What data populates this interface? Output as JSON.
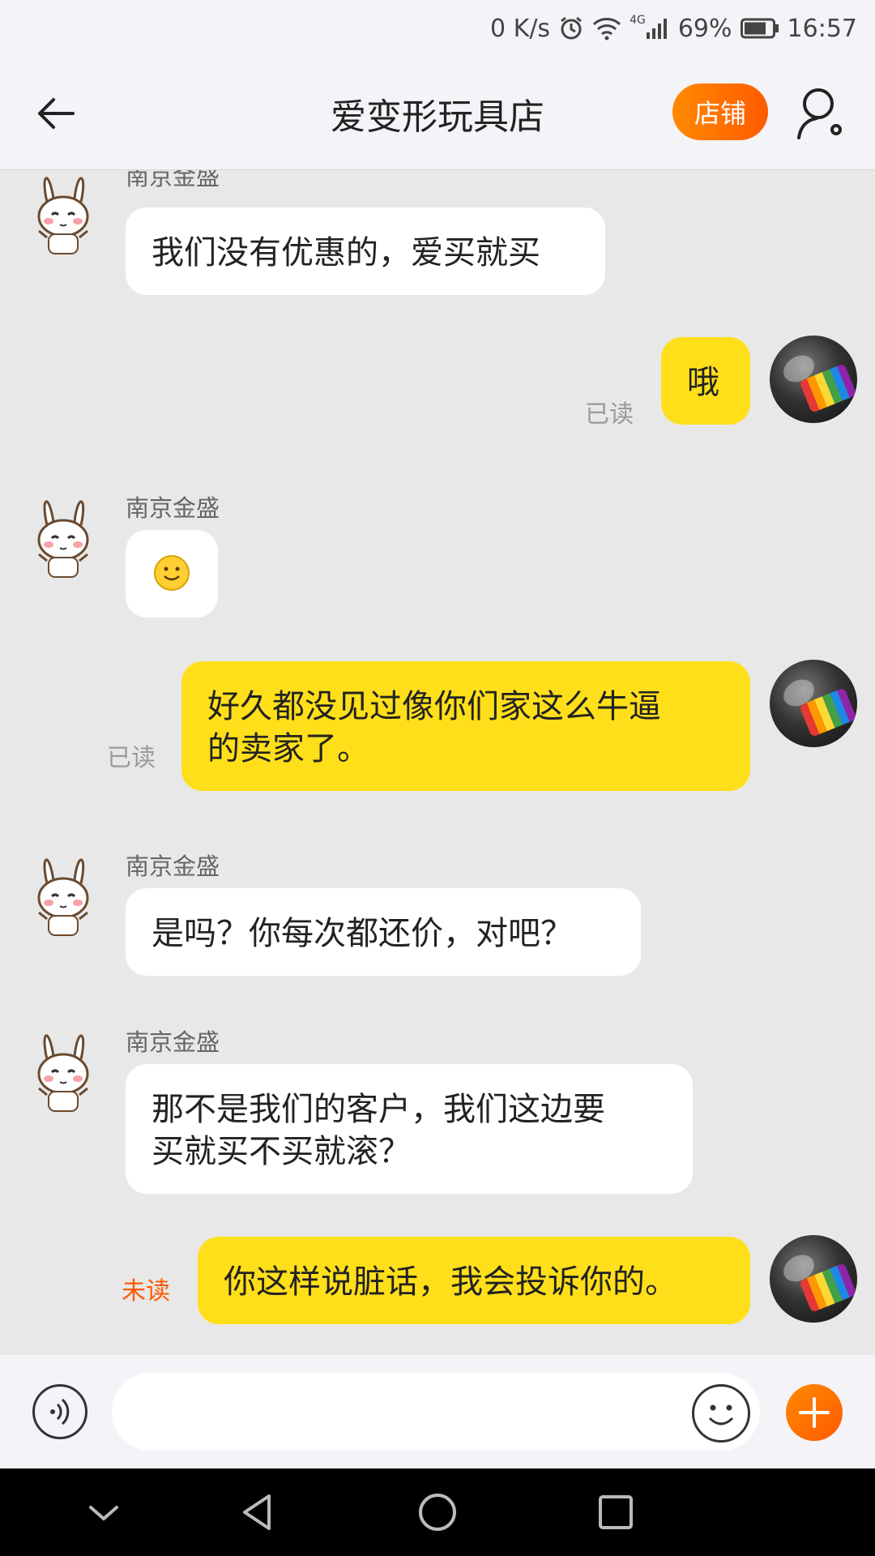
{
  "status_bar": {
    "network_speed": "0 K/s",
    "network_type": "4G",
    "battery_percent": "69%",
    "time": "16:57",
    "icons": [
      "alarm-icon",
      "wifi-icon",
      "signal-icon",
      "battery-icon"
    ]
  },
  "header": {
    "title": "爱变形玩具店",
    "shop_button_label": "店铺",
    "icons": [
      "back-arrow-icon",
      "user-settings-icon"
    ]
  },
  "messages": [
    {
      "direction": "in",
      "sender": "南京金盛",
      "text": "我们没有优惠的，爱买就买"
    },
    {
      "direction": "out",
      "text": "哦",
      "status": "已读"
    },
    {
      "direction": "in",
      "sender": "南京金盛",
      "emoji": "smile-emoji"
    },
    {
      "direction": "out",
      "text_lines": [
        "好久都没见过像你们家这么牛逼",
        "的卖家了。"
      ],
      "status": "已读"
    },
    {
      "direction": "in",
      "sender": "南京金盛",
      "text": "是吗？你每次都还价，对吧？"
    },
    {
      "direction": "in",
      "sender": "南京金盛",
      "text_lines": [
        "那不是我们的客户，我们这边要",
        "买就买不买就滚？"
      ]
    },
    {
      "direction": "out",
      "text": "你这样说脏话，我会投诉你的。",
      "status": "未读"
    }
  ],
  "input_bar": {
    "placeholder": "",
    "icons": [
      "voice-icon",
      "emoji-icon",
      "plus-icon"
    ]
  },
  "nav_bar": {
    "icons": [
      "collapse-icon",
      "back-triangle-icon",
      "home-circle-icon",
      "recents-square-icon"
    ]
  },
  "colors": {
    "accent_orange": "#ff6a00",
    "outgoing_bubble": "#ffdf1a",
    "incoming_bubble": "#ffffff",
    "chat_background": "#e8e8e8",
    "unread_text": "#ff5a00"
  }
}
